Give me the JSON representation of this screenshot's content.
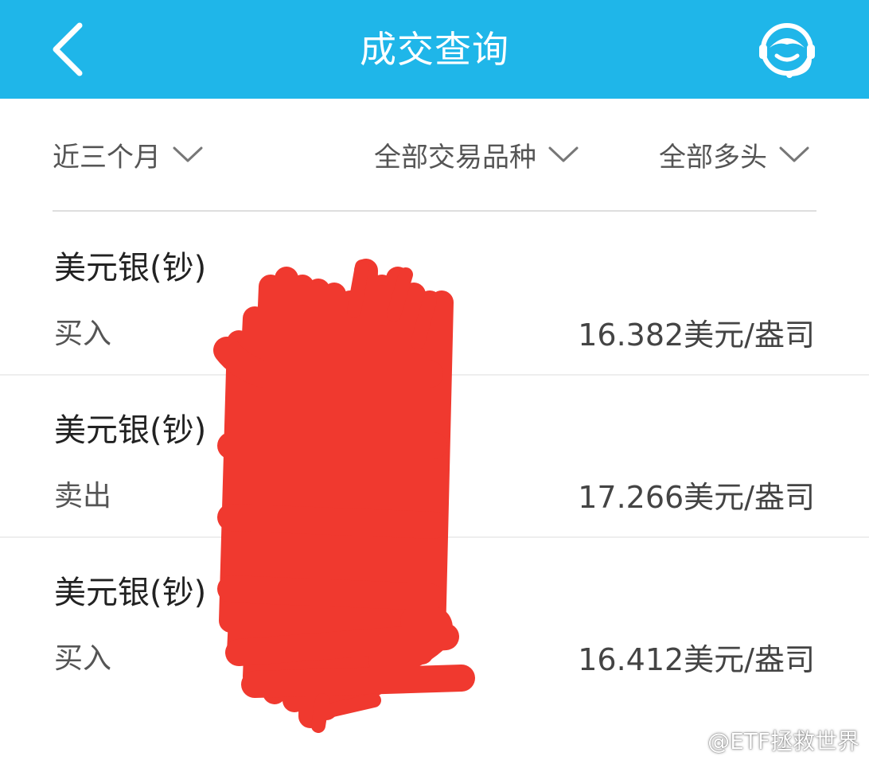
{
  "header": {
    "title": "成交查询",
    "back_icon": "chevron-left-icon",
    "service_icon": "customer-service-icon",
    "background_color": "#1fb6e9"
  },
  "filters": {
    "period": "近三个月",
    "product": "全部交易品种",
    "direction": "全部多头",
    "dropdown_icon": "chevron-down-icon"
  },
  "records": [
    {
      "name": "美元银(钞)",
      "side": "买入",
      "price": "16.382美元/盎司"
    },
    {
      "name": "美元银(钞)",
      "side": "卖出",
      "price": "17.266美元/盎司"
    },
    {
      "name": "美元银(钞)",
      "side": "买入",
      "price": "16.412美元/盎司"
    }
  ],
  "redaction": {
    "color": "#f0392f"
  },
  "watermark": {
    "text": "@ETF拯救世界",
    "icon": "weibo-icon"
  }
}
